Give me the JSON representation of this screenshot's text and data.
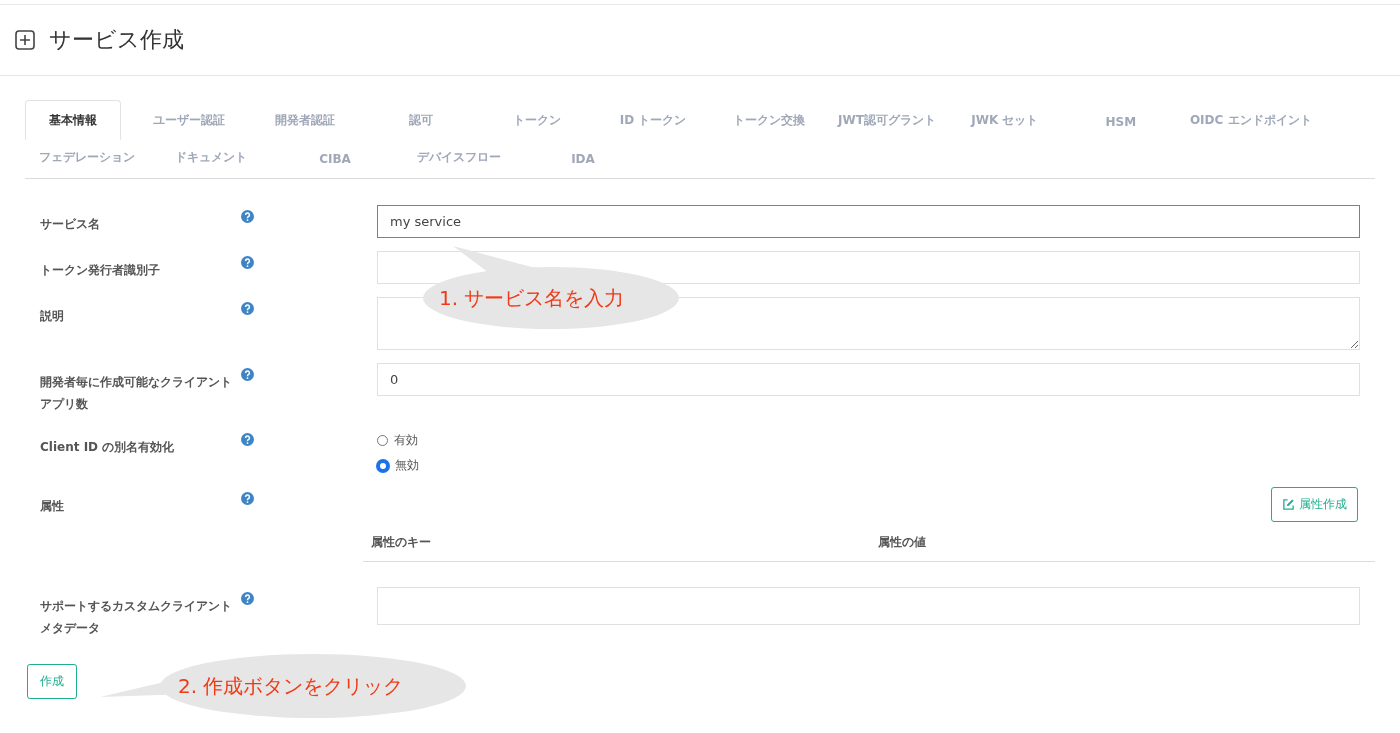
{
  "page": {
    "title": "サービス作成"
  },
  "tabs": [
    {
      "label": "基本情報",
      "selected": true
    },
    {
      "label": "ユーザー認証",
      "selected": false
    },
    {
      "label": "開発者認証",
      "selected": false
    },
    {
      "label": "認可",
      "selected": false
    },
    {
      "label": "トークン",
      "selected": false
    },
    {
      "label": "ID トークン",
      "selected": false
    },
    {
      "label": "トークン交換",
      "selected": false
    },
    {
      "label": "JWT認可グラント",
      "selected": false
    },
    {
      "label": "JWK セット",
      "selected": false
    },
    {
      "label": "HSM",
      "selected": false
    },
    {
      "label": "OIDC エンドポイント",
      "selected": false
    },
    {
      "label": "フェデレーション",
      "selected": false
    },
    {
      "label": "ドキュメント",
      "selected": false
    },
    {
      "label": "CIBA",
      "selected": false
    },
    {
      "label": "デバイスフロー",
      "selected": false
    },
    {
      "label": "IDA",
      "selected": false
    }
  ],
  "fields": [
    {
      "kind": "text",
      "label": "サービス名",
      "value": "my service",
      "focused": true
    },
    {
      "kind": "text",
      "label": "トークン発行者識別子",
      "focused": false
    },
    {
      "kind": "textarea",
      "label": "説明"
    },
    {
      "kind": "text",
      "label": "開発者毎に作成可能なクライアントアプリ数",
      "value": "0",
      "focused": false
    },
    {
      "kind": "radio",
      "label": "Client ID の別名有効化",
      "options": [
        {
          "label": "有効",
          "selected": false
        },
        {
          "label": "無効",
          "selected": true
        }
      ]
    },
    {
      "kind": "attributes",
      "label": "属性",
      "button": "属性作成",
      "columns": [
        "属性のキー",
        "属性の値"
      ]
    },
    {
      "kind": "text",
      "label": "サポートするカスタムクライアントメタデータ",
      "focused": false
    }
  ],
  "submit": "作成",
  "callouts": [
    {
      "text": "1. サービス名を入力"
    },
    {
      "text": "2. 作成ボタンをクリック"
    }
  ]
}
